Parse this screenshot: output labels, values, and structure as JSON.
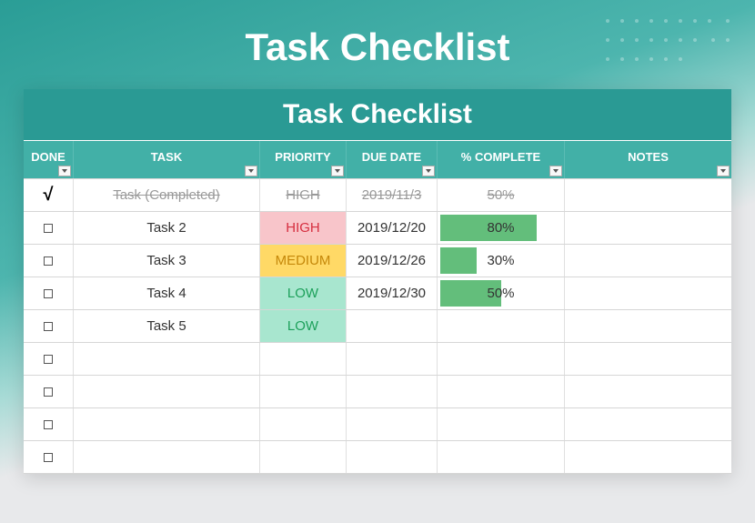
{
  "page_title": "Task Checklist",
  "sheet_title": "Task Checklist",
  "columns": {
    "done": "DONE",
    "task": "TASK",
    "priority": "PRIORITY",
    "due": "DUE DATE",
    "complete": "% COMPLETE",
    "notes": "NOTES"
  },
  "rows": [
    {
      "done": true,
      "task": "Task (Completed)",
      "priority": "HIGH",
      "due": "2019/11/3",
      "complete": "50%",
      "pct": 50,
      "notes": ""
    },
    {
      "done": false,
      "task": "Task 2",
      "priority": "HIGH",
      "due": "2019/12/20",
      "complete": "80%",
      "pct": 80,
      "notes": ""
    },
    {
      "done": false,
      "task": "Task 3",
      "priority": "MEDIUM",
      "due": "2019/12/26",
      "complete": "30%",
      "pct": 30,
      "notes": ""
    },
    {
      "done": false,
      "task": "Task 4",
      "priority": "LOW",
      "due": "2019/12/30",
      "complete": "50%",
      "pct": 50,
      "notes": ""
    },
    {
      "done": false,
      "task": "Task 5",
      "priority": "LOW",
      "due": "",
      "complete": "",
      "pct": null,
      "notes": ""
    },
    {
      "done": false,
      "task": "",
      "priority": "",
      "due": "",
      "complete": "",
      "pct": null,
      "notes": ""
    },
    {
      "done": false,
      "task": "",
      "priority": "",
      "due": "",
      "complete": "",
      "pct": null,
      "notes": ""
    },
    {
      "done": false,
      "task": "",
      "priority": "",
      "due": "",
      "complete": "",
      "pct": null,
      "notes": ""
    },
    {
      "done": false,
      "task": "",
      "priority": "",
      "due": "",
      "complete": "",
      "pct": null,
      "notes": ""
    }
  ]
}
